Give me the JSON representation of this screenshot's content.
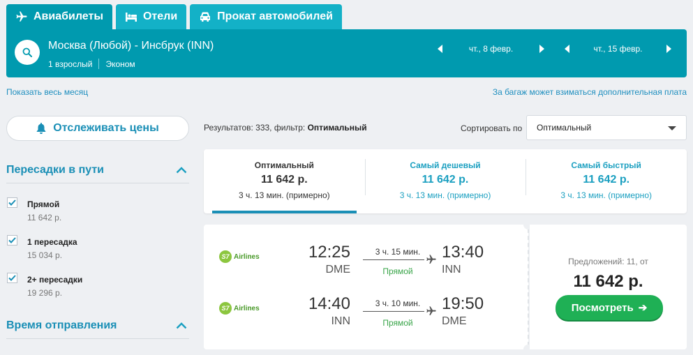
{
  "tabs": [
    {
      "label": "Авиабилеты",
      "icon": "plane-icon",
      "active": true
    },
    {
      "label": "Отели",
      "icon": "bed-icon",
      "active": false
    },
    {
      "label": "Прокат автомобилей",
      "icon": "car-icon",
      "active": false
    }
  ],
  "search": {
    "route": "Москва (Любой) - Инсбрук (INN)",
    "passengers": "1 взрослый",
    "cabin_class": "Эконом",
    "depart_date": "чт., 8 февр.",
    "return_date": "чт., 15 февр."
  },
  "links": {
    "whole_month": "Показать весь месяц",
    "baggage_note": "За багаж может взиматься дополнительная плата"
  },
  "sidebar": {
    "track_prices_label": "Отслеживать цены",
    "stops_title": "Пересадки в пути",
    "stops_options": [
      {
        "name": "Прямой",
        "price": "11 642 р.",
        "checked": true
      },
      {
        "name": "1 пересадка",
        "price": "15 034 р.",
        "checked": true
      },
      {
        "name": "2+ пересадки",
        "price": "19 296 р.",
        "checked": true
      }
    ],
    "departure_title": "Время отправления"
  },
  "results": {
    "summary_prefix": "Результатов: 333, фильтр: ",
    "summary_filter": "Оптимальный",
    "sort_label": "Сортировать по",
    "sort_value": "Оптимальный"
  },
  "sort_tabs": [
    {
      "title": "Оптимальный",
      "price": "11 642 р.",
      "duration": "3 ч. 13 мин. (примерно)",
      "active": true
    },
    {
      "title": "Самый дешевый",
      "price": "11 642 р.",
      "duration": "3 ч. 13 мин. (примерно)",
      "active": false
    },
    {
      "title": "Самый быстрый",
      "price": "11 642 р.",
      "duration": "3 ч. 13 мин. (примерно)",
      "active": false
    }
  ],
  "ticket": {
    "segments": [
      {
        "airline": "Airlines",
        "logo": "S7",
        "dep_time": "12:25",
        "dep_code": "DME",
        "duration": "3 ч. 15 мин.",
        "stops": "Прямой",
        "arr_time": "13:40",
        "arr_code": "INN"
      },
      {
        "airline": "Airlines",
        "logo": "S7",
        "dep_time": "14:40",
        "dep_code": "INN",
        "duration": "3 ч. 10 мин.",
        "stops": "Прямой",
        "arr_time": "19:50",
        "arr_code": "DME"
      }
    ],
    "offers": "Предложений: 11, от",
    "price": "11 642 р.",
    "view_label": "Посмотреть",
    "view_arrow": "➔"
  },
  "colors": {
    "brand_teal": "#009aaf",
    "tab_teal": "#13b1c7",
    "link_blue": "#1a8fb6",
    "cta_green": "#1fb055",
    "direct_green": "#3aa54a"
  }
}
